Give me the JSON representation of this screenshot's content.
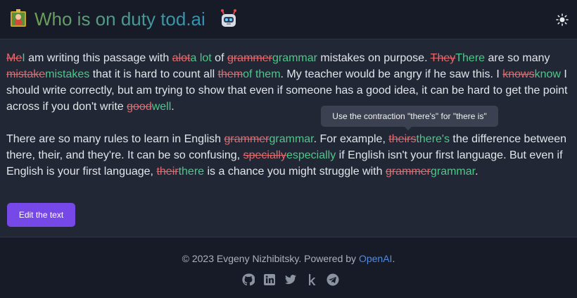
{
  "header": {
    "title": "Who is on duty tod.ai",
    "logo_icon": "book-emoji-icon",
    "robot_icon": "robot-emoji-icon",
    "theme_toggle_icon": "sun-icon"
  },
  "content": {
    "p1": {
      "seg01": "Me",
      "seg02": "I",
      "seg03": " am writing this passage with ",
      "seg04": "alot",
      "seg05": "a lot",
      "seg06": " of ",
      "seg07": "grammer",
      "seg08": "grammar",
      "seg09": " mistakes on purpose. ",
      "seg10": "They",
      "seg11": "There",
      "seg12": " are so many ",
      "seg13": "mistake",
      "seg14": "mistakes",
      "seg15": " that it is hard to count all ",
      "seg16": "them",
      "seg17": "of them",
      "seg18": ". My teacher would be angry if he saw this. I ",
      "seg19": "knows",
      "seg20": "know",
      "seg21": " I should write correctly, but am trying to show that even if someone has a good idea, it can be hard to get the point across if you don't write ",
      "seg22": "good",
      "seg23": "well",
      "seg24": "."
    },
    "p2": {
      "seg01": "There are so many rules to learn in English ",
      "seg02": "grammer",
      "seg03": "grammar",
      "seg04": ". For example, ",
      "seg05": "theirs",
      "seg06": "there's",
      "seg07": " the difference between there, their, and they're. It can be so confusing, ",
      "seg08": "specially",
      "seg09": "especially",
      "seg10": " if English isn't your first language. But even if English is your first language, ",
      "seg11": "their",
      "seg12": "there",
      "seg13": " is a chance you might struggle with ",
      "seg14": "grammer",
      "seg15": "grammar",
      "seg16": "."
    },
    "tooltip": "Use the contraction \"there's\" for \"there is\""
  },
  "actions": {
    "edit_label": "Edit the text"
  },
  "footer": {
    "copyright_prefix": "© 2023 Evgeny Nizhibitsky. Powered by ",
    "copyright_link": "OpenAI",
    "copyright_suffix": ".",
    "socials": [
      "github-icon",
      "linkedin-icon",
      "twitter-icon",
      "kaggle-icon",
      "telegram-icon"
    ]
  },
  "colors": {
    "background": "#212735",
    "header_bg": "#161b27",
    "deleted": "#e06b6f",
    "inserted": "#4fc789",
    "button": "#7748e8",
    "link": "#4d8be6"
  }
}
